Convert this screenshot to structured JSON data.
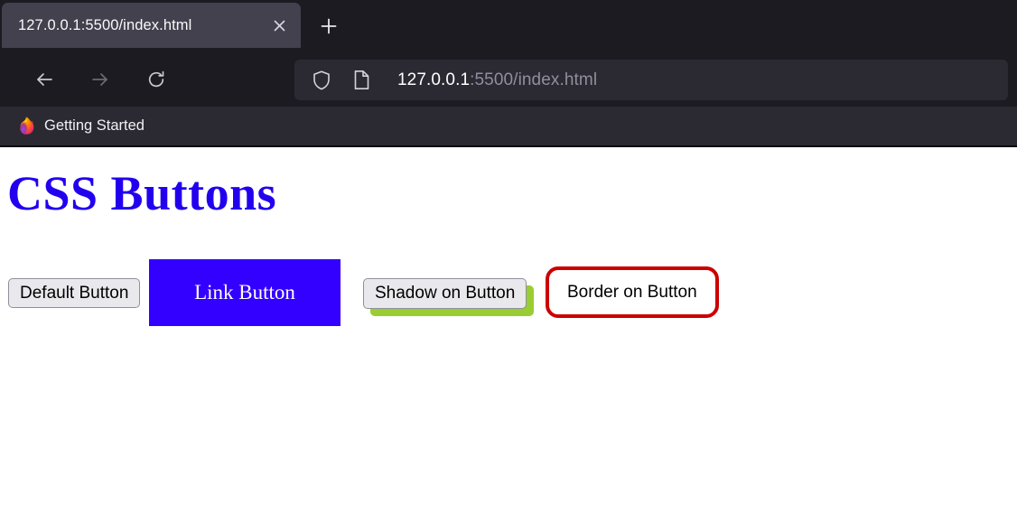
{
  "browser": {
    "tab": {
      "title": "127.0.0.1:5500/index.html",
      "close_icon": "close-icon"
    },
    "new_tab_icon": "plus-icon",
    "toolbar": {
      "back_icon": "arrow-left-icon",
      "forward_icon": "arrow-right-icon",
      "reload_icon": "reload-icon"
    },
    "url_bar": {
      "shield_icon": "shield-icon",
      "page_icon": "page-document-icon",
      "host": "127.0.0.1",
      "path": ":5500/index.html",
      "full_url": "127.0.0.1:5500/index.html"
    },
    "bookmarks": [
      {
        "label": "Getting Started",
        "icon": "firefox-logo-icon"
      }
    ],
    "colors": {
      "chrome_dark": "#1c1b22",
      "tab_active": "#42414d",
      "urlbar_field": "#2b2a33",
      "bookmarks_bar": "#2b2a33",
      "text_light": "#f9f9fa",
      "text_muted": "#8f8f9d"
    }
  },
  "page": {
    "heading": "CSS Buttons",
    "heading_color": "#2200ee",
    "background": "#ffffff",
    "buttons": [
      {
        "name": "default-button",
        "label": "Default Button",
        "style": "default",
        "background": "#e9e9ed",
        "text_color": "#000000",
        "border_color": "#8f8f9d"
      },
      {
        "name": "link-button",
        "label": "Link Button",
        "style": "link",
        "background": "#3300ff",
        "text_color": "#ffffff"
      },
      {
        "name": "shadow-button",
        "label": "Shadow on Button",
        "style": "shadow",
        "background": "#e9e9ed",
        "text_color": "#000000",
        "shadow_color": "#9acd32"
      },
      {
        "name": "border-button",
        "label": "Border on Button",
        "style": "border",
        "background": "#ffffff",
        "text_color": "#000000",
        "border_color": "#cc0000"
      }
    ]
  }
}
